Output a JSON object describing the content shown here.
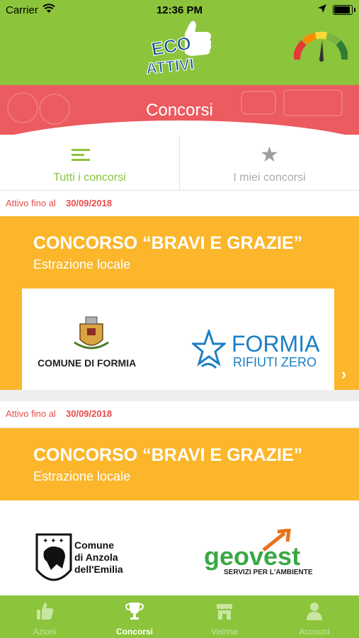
{
  "status_bar": {
    "carrier": "Carrier",
    "time": "12:36 PM"
  },
  "app": {
    "logo_line1": "ECO",
    "logo_line2": "ATTIVI",
    "brand_green": "#8cc43c",
    "accent_red": "#ec5b5f",
    "accent_yellow": "#fbb62b"
  },
  "banner": {
    "title": "Concorsi"
  },
  "tabs": [
    {
      "label": "Tutti i concorsi",
      "icon": "list-icon",
      "active": true
    },
    {
      "label": "I miei concorsi",
      "icon": "star-icon",
      "active": false
    }
  ],
  "contests": [
    {
      "active_prefix": "Attivo fino al",
      "active_date": "30/09/2018",
      "title": "CONCORSO “BRAVI E GRAZIE”",
      "subtitle": "Estrazione locale",
      "logo_left": "COMUNE DI FORMIA",
      "logo_right_line1": "FORMIA",
      "logo_right_line2": "RIFIUTI ZERO"
    },
    {
      "active_prefix": "Attivo fino al",
      "active_date": "30/09/2018",
      "title": "CONCORSO “BRAVI E GRAZIE”",
      "subtitle": "Estrazione locale",
      "logo_left_line1": "Comune",
      "logo_left_line2": "di Anzola",
      "logo_left_line3": "dell'Emilia",
      "logo_right_brand_a": "geo",
      "logo_right_brand_b": "vest",
      "logo_right_tagline": "SERVIZI PER L'AMBIENTE"
    }
  ],
  "nav": [
    {
      "label": "Azioni",
      "icon": "thumbs-up-icon",
      "active": false
    },
    {
      "label": "Concorsi",
      "icon": "trophy-icon",
      "active": true
    },
    {
      "label": "Vetrina",
      "icon": "shop-icon",
      "active": false
    },
    {
      "label": "Account",
      "icon": "user-icon",
      "active": false
    }
  ]
}
